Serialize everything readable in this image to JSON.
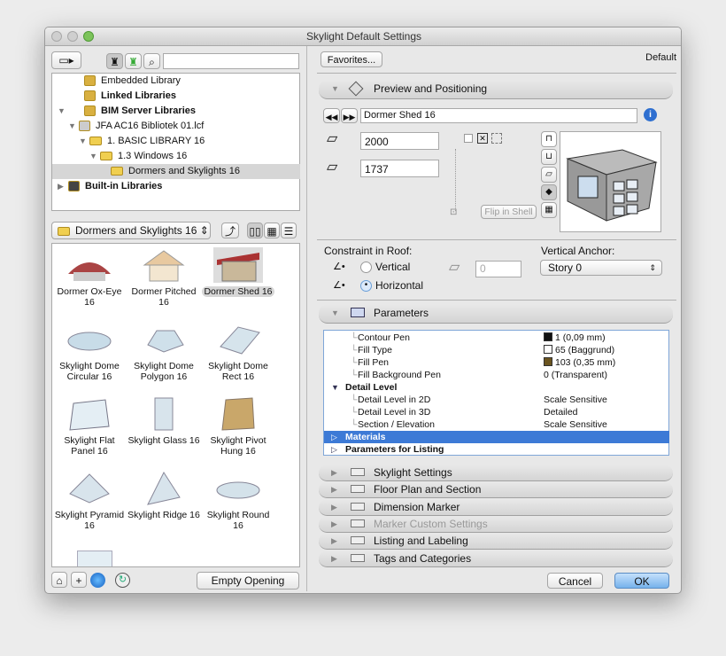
{
  "window": {
    "title": "Skylight Default Settings"
  },
  "left": {
    "tree": [
      {
        "label": "Embedded Library",
        "bold": false
      },
      {
        "label": "Linked Libraries",
        "bold": true
      },
      {
        "label": "BIM Server Libraries",
        "bold": true
      },
      {
        "label": "JFA AC16 Bibliotek 01.lcf",
        "bold": false
      },
      {
        "label": "1. BASIC LIBRARY 16",
        "bold": false
      },
      {
        "label": "1.3 Windows 16",
        "bold": false
      },
      {
        "label": "Dormers and Skylights 16",
        "bold": false,
        "selected": true
      },
      {
        "label": "Built-in Libraries",
        "bold": true
      }
    ],
    "folder_popup": "Dormers and Skylights 16",
    "items": [
      "Dormer Ox-Eye 16",
      "Dormer Pitched 16",
      "Dormer Shed 16",
      "Skylight Dome Circular 16",
      "Skylight Dome Polygon 16",
      "Skylight Dome Rect 16",
      "Skylight Flat Panel 16",
      "Skylight Glass 16",
      "Skylight Pivot Hung 16",
      "Skylight Pyramid 16",
      "Skylight Ridge 16",
      "Skylight Round 16"
    ],
    "selected_item": "Dormer Shed 16",
    "empty_opening": "Empty Opening"
  },
  "right": {
    "favorites": "Favorites...",
    "default_label": "Default",
    "preview_section": "Preview and Positioning",
    "object_name": "Dormer Shed 16",
    "width": "2000",
    "height": "1737",
    "flip_in_shell": "Flip in Shell",
    "constraint_label": "Constraint in Roof:",
    "vertical": "Vertical",
    "horizontal": "Horizontal",
    "constraint_selected": "Horizontal",
    "offset": "0",
    "vertical_anchor_label": "Vertical Anchor:",
    "vertical_anchor": "Story 0",
    "parameters_section": "Parameters",
    "params": [
      {
        "name": "Contour Pen",
        "value": "1 (0,09 mm)",
        "swatch": "#111111",
        "indent": 2
      },
      {
        "name": "Fill Type",
        "value": "65 (Baggrund)",
        "swatch": "#ffffff",
        "indent": 2
      },
      {
        "name": "Fill Pen",
        "value": "103 (0,35 mm)",
        "swatch": "#6b5520",
        "indent": 2
      },
      {
        "name": "Fill Background Pen",
        "value": "0 (Transparent)",
        "indent": 2
      },
      {
        "name": "Detail Level",
        "value": "",
        "indent": 0,
        "group": true,
        "open": true
      },
      {
        "name": "Detail Level in 2D",
        "value": "Scale Sensitive",
        "indent": 2
      },
      {
        "name": "Detail Level in 3D",
        "value": "Detailed",
        "indent": 2
      },
      {
        "name": "Section / Elevation",
        "value": "Scale Sensitive",
        "indent": 2
      },
      {
        "name": "Materials",
        "value": "",
        "indent": 0,
        "group": true,
        "selected": true
      },
      {
        "name": "Parameters for Listing",
        "value": "",
        "indent": 0,
        "group": true
      }
    ],
    "sections": [
      {
        "label": "Skylight Settings",
        "disabled": false
      },
      {
        "label": "Floor Plan and Section",
        "disabled": false
      },
      {
        "label": "Dimension Marker",
        "disabled": false
      },
      {
        "label": "Marker Custom Settings",
        "disabled": true
      },
      {
        "label": "Listing and Labeling",
        "disabled": false
      },
      {
        "label": "Tags and Categories",
        "disabled": false
      }
    ],
    "cancel": "Cancel",
    "ok": "OK"
  },
  "colors": {
    "selection": "#3d7ad6",
    "ok": "#8cc0f0"
  }
}
